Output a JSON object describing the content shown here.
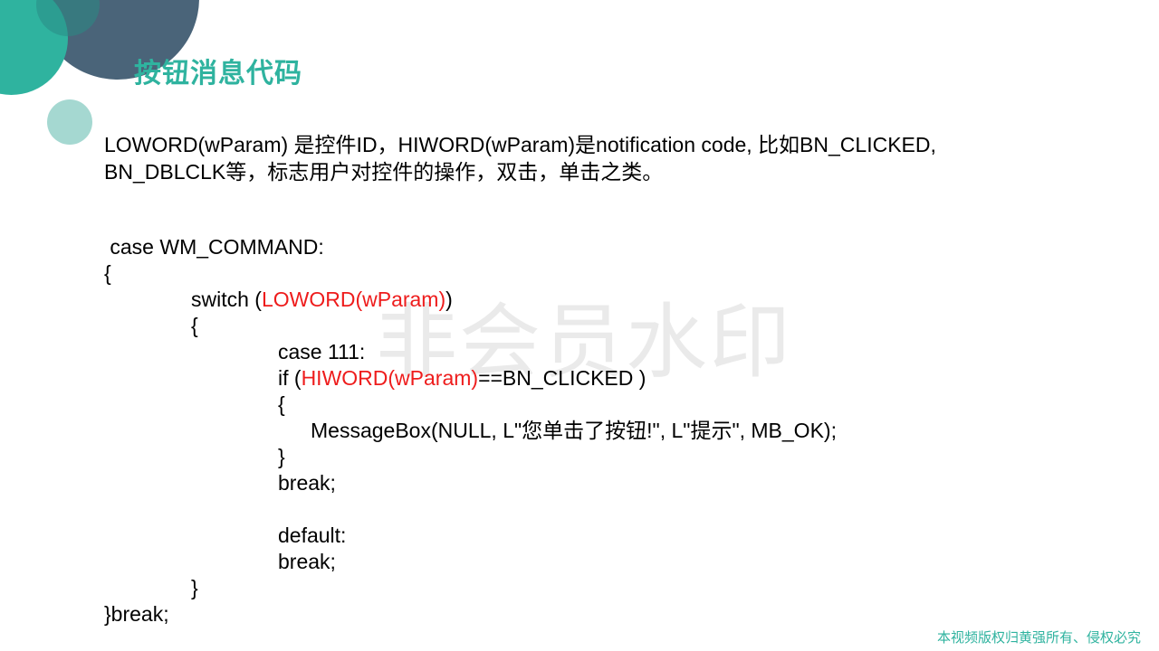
{
  "title": "按钮消息代码",
  "intro": {
    "line1": "LOWORD(wParam) 是控件ID，HIWORD(wParam)是notification code, 比如BN_CLICKED,",
    "line2": "BN_DBLCLK等，标志用户对控件的操作，双击，单击之类。"
  },
  "code": {
    "l1": " case WM_COMMAND:",
    "l2": "{",
    "l3_a": "switch (",
    "l3_b": "LOWORD(wParam)",
    "l3_c": ")",
    "l4": "{",
    "l5": "case 111:",
    "l6_a": "if (",
    "l6_b": "HIWORD(wParam)",
    "l6_c": "==BN_CLICKED )",
    "l7": "{",
    "l8": "MessageBox(NULL, L\"您单击了按钮!\", L\"提示\", MB_OK);",
    "l9": "}",
    "l10": "break;",
    "l12": "default:",
    "l13": "break;",
    "l14": "}",
    "l15": "}break;"
  },
  "watermark": "非会员水印",
  "footer": "本视频版权归黄强所有、侵权必究",
  "colors": {
    "accent": "#2fb39f",
    "dark_circle": "#4a6479",
    "light_circle": "#a5d8d1",
    "code_highlight": "#ee1c1c"
  }
}
